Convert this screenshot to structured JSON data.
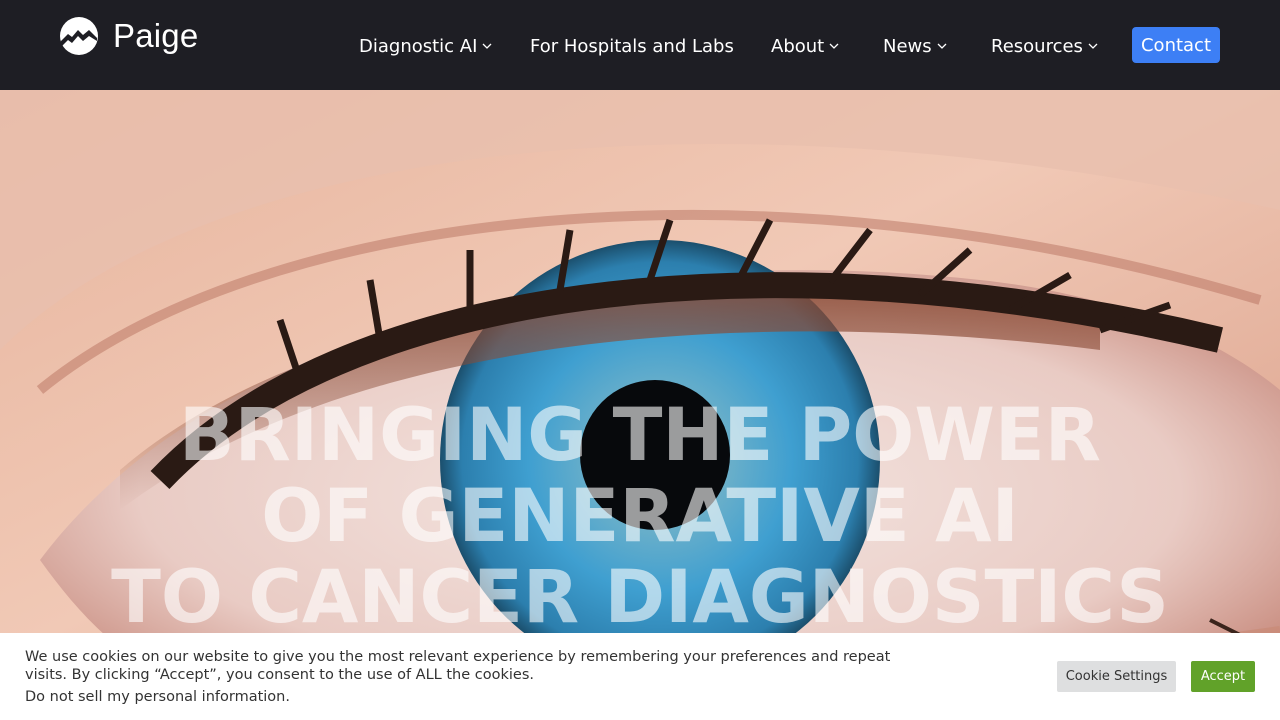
{
  "brand": {
    "name": "Paige",
    "logo_icon": "paige-logo-icon"
  },
  "nav": {
    "items": [
      {
        "label": "Diagnostic AI",
        "has_dropdown": true
      },
      {
        "label": "For Hospitals and Labs",
        "has_dropdown": false
      },
      {
        "label": "About",
        "has_dropdown": true
      },
      {
        "label": "News",
        "has_dropdown": true
      },
      {
        "label": "Resources",
        "has_dropdown": true
      }
    ],
    "contact_label": "Contact"
  },
  "hero": {
    "headline_lines": [
      "BRINGING THE POWER",
      "OF GENERATIVE AI",
      "TO CANCER DIAGNOSTICS"
    ],
    "background": "close-up blue eye image"
  },
  "cookie_banner": {
    "message": "We use cookies on our website to give you the most relevant experience by remembering your preferences and repeat visits. By clicking “Accept”, you consent to the use of ALL the cookies.",
    "do_not_sell": "Do not sell my personal information.",
    "settings_label": "Cookie Settings",
    "accept_label": "Accept"
  },
  "colors": {
    "header_bg": "#1e1e24",
    "contact_button": "#3d7ff5",
    "accept_button": "#61a229",
    "settings_button": "#dedfe0"
  }
}
